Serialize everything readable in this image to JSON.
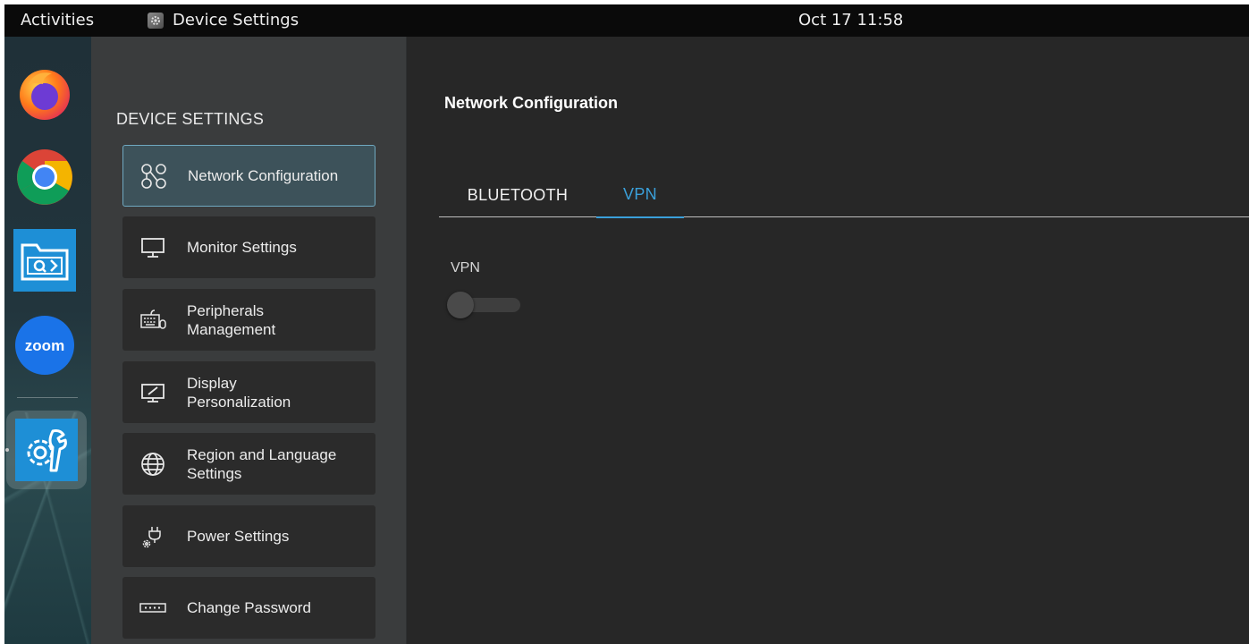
{
  "topbar": {
    "activities": "Activities",
    "app_name": "Device Settings",
    "clock": "Oct 17  11:58"
  },
  "dock": {
    "items": [
      {
        "name": "Firefox"
      },
      {
        "name": "Chrome"
      },
      {
        "name": "Remote Viewer"
      },
      {
        "name": "Zoom",
        "label": "zoom"
      },
      {
        "name": "Device Settings"
      }
    ]
  },
  "sidebar": {
    "title": "DEVICE SETTINGS",
    "items": [
      {
        "label": "Network Configuration",
        "icon": "network-icon"
      },
      {
        "label": "Monitor Settings",
        "icon": "monitor-icon"
      },
      {
        "label": "Peripherals\nManagement",
        "icon": "keyboard-mouse-icon"
      },
      {
        "label": "Display\nPersonalization",
        "icon": "display-brush-icon"
      },
      {
        "label": "Region and Language\nSettings",
        "icon": "globe-icon"
      },
      {
        "label": "Power Settings",
        "icon": "power-plug-icon"
      },
      {
        "label": "Change Password",
        "icon": "password-icon"
      }
    ]
  },
  "main": {
    "title": "Network Configuration",
    "tabs": [
      {
        "label": "BLUETOOTH"
      },
      {
        "label": "VPN",
        "active": true
      }
    ],
    "vpn": {
      "label": "VPN",
      "enabled": false
    }
  },
  "colors": {
    "accent": "#3aa0da",
    "main_bg": "#272727",
    "sidebar_bg": "#3a3c3d",
    "selected_item": "#3d525a"
  }
}
